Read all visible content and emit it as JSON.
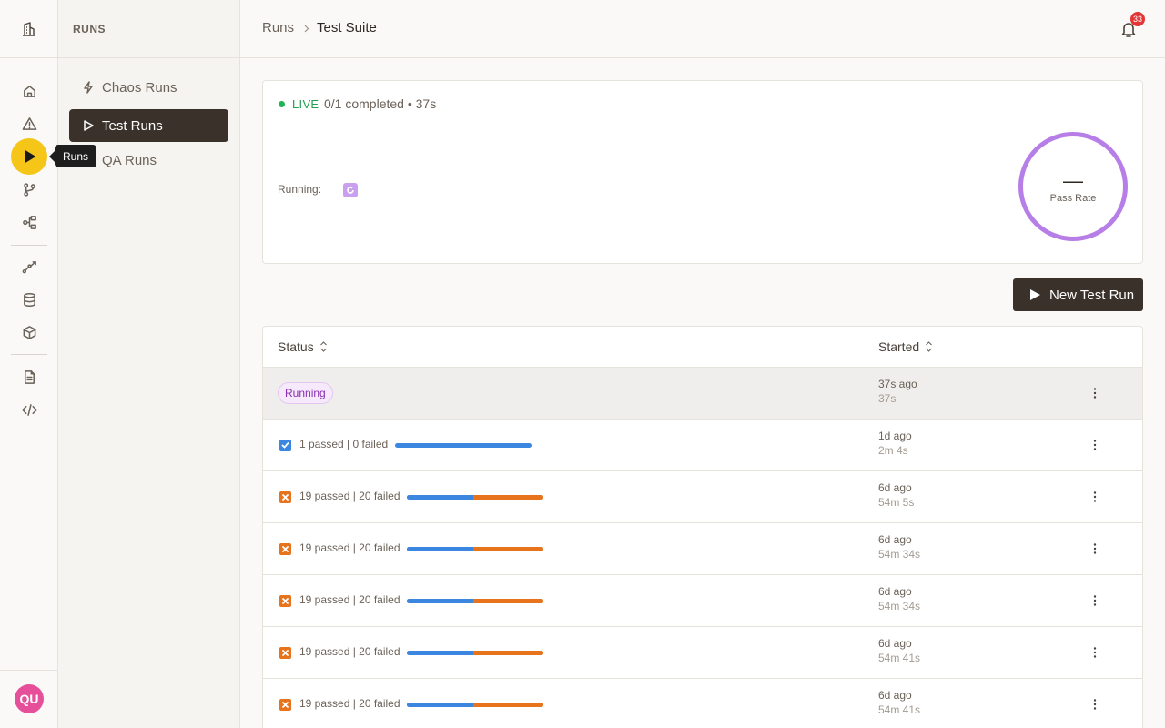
{
  "sidebar": {
    "section_title": "RUNS",
    "items": [
      {
        "label": "Chaos Runs",
        "icon": "lightning-icon"
      },
      {
        "label": "Test Runs",
        "icon": "play-outline-icon",
        "active": true
      },
      {
        "label": "QA Runs",
        "icon": "play-outline-icon"
      }
    ]
  },
  "rail": {
    "tooltip": "Runs",
    "icons": [
      "building-icon",
      "home-icon",
      "warning-icon",
      "play-icon",
      "git-branch-icon",
      "workflow-icon",
      "trend-icon",
      "database-icon",
      "package-icon",
      "document-icon",
      "code-icon"
    ],
    "avatar_initials": "QU"
  },
  "header": {
    "breadcrumb_root": "Runs",
    "breadcrumb_current": "Test Suite",
    "notification_count": "33"
  },
  "live": {
    "label": "LIVE",
    "progress": "0/1 completed • 37s",
    "running_label": "Running:",
    "pass_rate_value": "—",
    "pass_rate_label": "Pass Rate"
  },
  "actions": {
    "new_run_label": "New Test Run"
  },
  "colors": {
    "accent": "#f5c518",
    "dark": "#3a312a",
    "pass": "#3b86e0",
    "fail": "#e8731d",
    "live": "#21b356",
    "running": "#b67ee6"
  },
  "table": {
    "columns": [
      "Status",
      "Started"
    ],
    "rows": [
      {
        "status": "Running",
        "started": "37s ago",
        "duration": "37s"
      },
      {
        "status": "passed",
        "result": "1 passed | 0 failed",
        "pass_fraction": 1.0,
        "started": "1d ago",
        "duration": "2m 4s"
      },
      {
        "status": "failed",
        "result": "19 passed | 20 failed",
        "pass_fraction": 0.487,
        "started": "6d ago",
        "duration": "54m 5s"
      },
      {
        "status": "failed",
        "result": "19 passed | 20 failed",
        "pass_fraction": 0.487,
        "started": "6d ago",
        "duration": "54m 34s"
      },
      {
        "status": "failed",
        "result": "19 passed | 20 failed",
        "pass_fraction": 0.487,
        "started": "6d ago",
        "duration": "54m 34s"
      },
      {
        "status": "failed",
        "result": "19 passed | 20 failed",
        "pass_fraction": 0.487,
        "started": "6d ago",
        "duration": "54m 41s"
      },
      {
        "status": "failed",
        "result": "19 passed | 20 failed",
        "pass_fraction": 0.487,
        "started": "6d ago",
        "duration": "54m 41s"
      }
    ]
  }
}
